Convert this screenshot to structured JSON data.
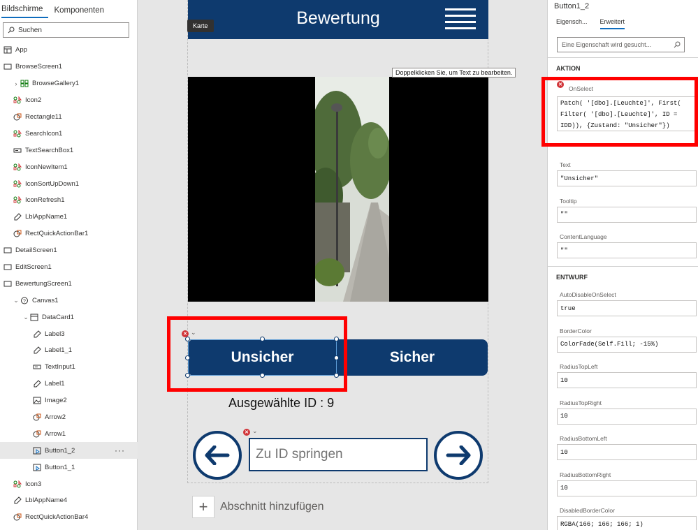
{
  "left_panel": {
    "tabs": [
      "Bildschirme",
      "Komponenten"
    ],
    "search_placeholder": "Suchen",
    "tree": [
      {
        "label": "App",
        "icon": "app-icon",
        "indent": 0
      },
      {
        "label": "BrowseScreen1",
        "icon": "screen-icon",
        "indent": 0
      },
      {
        "label": "BrowseGallery1",
        "icon": "gallery-icon",
        "indent": 1,
        "chevron": "›"
      },
      {
        "label": "Icon2",
        "icon": "icon-control-icon",
        "indent": 1
      },
      {
        "label": "Rectangle11",
        "icon": "shape-icon",
        "indent": 1
      },
      {
        "label": "SearchIcon1",
        "icon": "icon-control-icon",
        "indent": 1
      },
      {
        "label": "TextSearchBox1",
        "icon": "textinput-icon",
        "indent": 1
      },
      {
        "label": "IconNewItem1",
        "icon": "icon-control-icon",
        "indent": 1
      },
      {
        "label": "IconSortUpDown1",
        "icon": "icon-control-icon",
        "indent": 1
      },
      {
        "label": "IconRefresh1",
        "icon": "icon-control-icon",
        "indent": 1
      },
      {
        "label": "LblAppName1",
        "icon": "label-icon",
        "indent": 1
      },
      {
        "label": "RectQuickActionBar1",
        "icon": "shape-icon",
        "indent": 1
      },
      {
        "label": "DetailScreen1",
        "icon": "screen-icon",
        "indent": 0
      },
      {
        "label": "EditScreen1",
        "icon": "screen-icon",
        "indent": 0
      },
      {
        "label": "BewertungScreen1",
        "icon": "screen-icon",
        "indent": 0
      },
      {
        "label": "Canvas1",
        "icon": "canvas-icon",
        "indent": 1,
        "chevron": "⌄"
      },
      {
        "label": "DataCard1",
        "icon": "card-icon",
        "indent": 2,
        "chevron": "⌄"
      },
      {
        "label": "Label3",
        "icon": "label-icon",
        "indent": 3
      },
      {
        "label": "Label1_1",
        "icon": "label-icon",
        "indent": 3
      },
      {
        "label": "TextInput1",
        "icon": "textinput-icon",
        "indent": 3
      },
      {
        "label": "Label1",
        "icon": "label-icon",
        "indent": 3
      },
      {
        "label": "Image2",
        "icon": "image-icon",
        "indent": 3
      },
      {
        "label": "Arrow2",
        "icon": "shape-icon",
        "indent": 3
      },
      {
        "label": "Arrow1",
        "icon": "shape-icon",
        "indent": 3
      },
      {
        "label": "Button1_2",
        "icon": "button-icon",
        "indent": 3,
        "selected": true
      },
      {
        "label": "Button1_1",
        "icon": "button-icon",
        "indent": 3
      },
      {
        "label": "Icon3",
        "icon": "icon-control-icon",
        "indent": 1
      },
      {
        "label": "LblAppName4",
        "icon": "label-icon",
        "indent": 1
      },
      {
        "label": "RectQuickActionBar4",
        "icon": "shape-icon",
        "indent": 1
      }
    ],
    "more_label": "···"
  },
  "canvas": {
    "header_title": "Bewertung",
    "karte_tooltip": "Karte",
    "edit_tooltip": "Doppelklicken Sie, um Text zu bearbeiten.",
    "btn_unsicher": "Unsicher",
    "btn_sicher": "Sicher",
    "ausgewaehlte_label": "Ausgewählte ID :  9",
    "id_input_placeholder": "Zu ID springen",
    "add_section": "Abschnitt hinzufügen",
    "accent_color": "#0e3a6e"
  },
  "right_panel": {
    "control_name": "Button1_2",
    "tabs": [
      "Eigensch...",
      "Erweitert"
    ],
    "search_placeholder": "Eine Eigenschaft wird gesucht...",
    "sections": {
      "aktion": "AKTION",
      "entwurf": "ENTWURF"
    },
    "onselect_label": "OnSelect",
    "onselect_formula": "Patch( '[dbo].[Leuchte]', First( Filter( '[dbo].[Leuchte]', ID = IDD)), {Zustand: \"Unsicher\"})",
    "props_daten": [
      {
        "label": "Text",
        "value": "\"Unsicher\""
      },
      {
        "label": "Tooltip",
        "value": "\"\""
      },
      {
        "label": "ContentLanguage",
        "value": "\"\""
      }
    ],
    "props_entwurf": [
      {
        "label": "AutoDisableOnSelect",
        "value": "true"
      },
      {
        "label": "BorderColor",
        "value": "ColorFade(Self.Fill; -15%)"
      },
      {
        "label": "RadiusTopLeft",
        "value": "10"
      },
      {
        "label": "RadiusTopRight",
        "value": "10"
      },
      {
        "label": "RadiusBottomLeft",
        "value": "10"
      },
      {
        "label": "RadiusBottomRight",
        "value": "10"
      },
      {
        "label": "DisabledBorderColor",
        "value": "RGBA(166; 166; 166; 1)"
      }
    ]
  }
}
